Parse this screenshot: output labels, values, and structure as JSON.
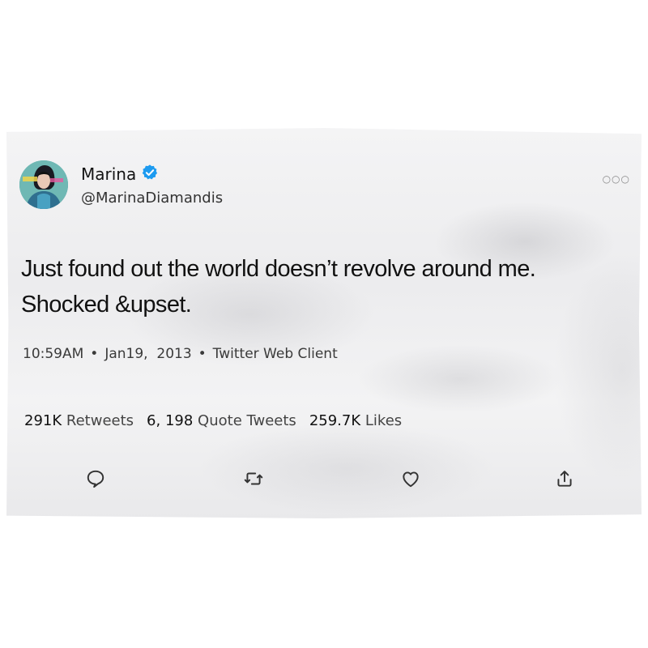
{
  "user": {
    "display_name": "Marina",
    "handle": "@MarinaDiamandis",
    "verified_icon": "verified-badge-icon",
    "avatar_icon": "profile-avatar"
  },
  "tweet": {
    "text": "Just found out the world doesn’t revolve around me.\nShocked &upset.",
    "time": "10:59AM",
    "date": "Jan19,  2013",
    "client": "Twitter Web Client",
    "separator": "•"
  },
  "stats": {
    "retweets_count": "291K",
    "retweets_label": "Retweets",
    "quote_count": "6, 198",
    "quote_label": "Quote Tweets",
    "likes_count": "259.7K",
    "likes_label": "Likes"
  },
  "menu": {
    "more_label": "○○○"
  },
  "actions": [
    {
      "icon": "reply-icon"
    },
    {
      "icon": "retweet-icon"
    },
    {
      "icon": "like-icon"
    },
    {
      "icon": "share-icon"
    }
  ],
  "colors": {
    "verified": "#1d9bf0",
    "text": "#111111",
    "muted": "#3a3a3a"
  }
}
